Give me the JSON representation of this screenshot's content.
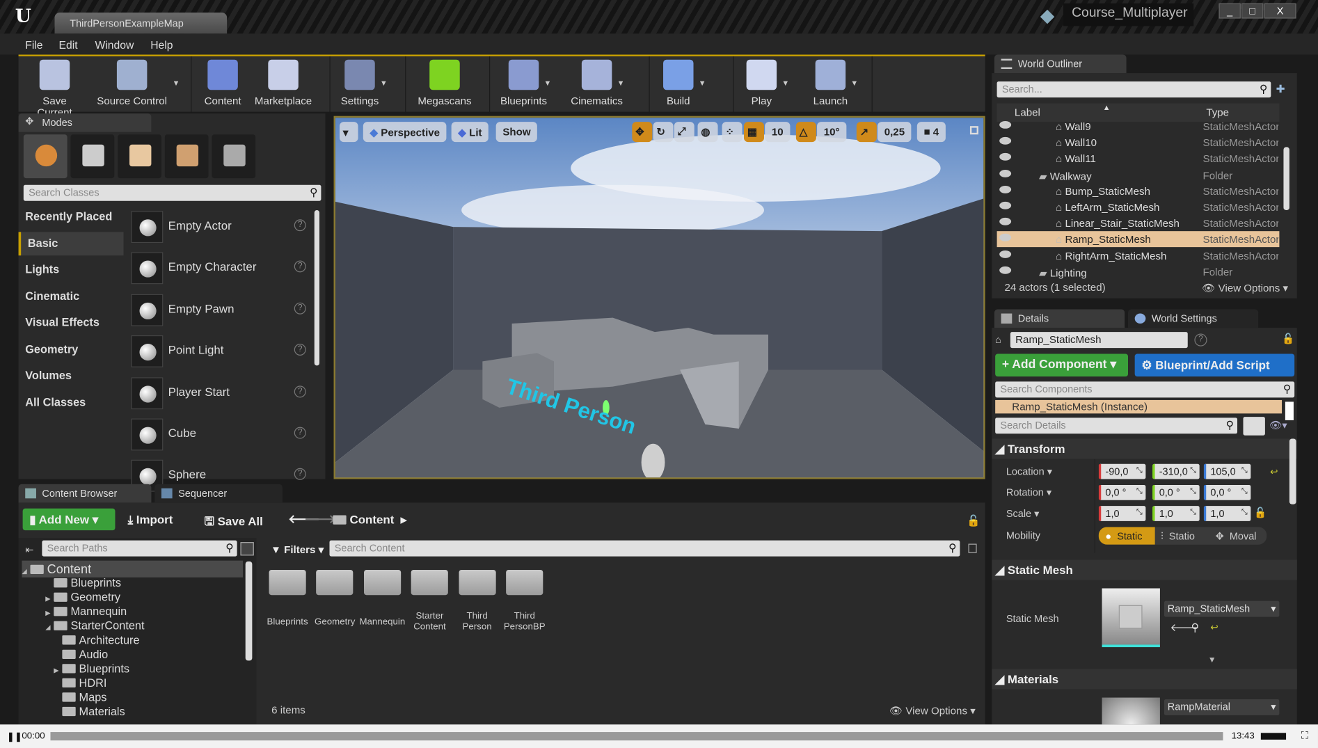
{
  "window": {
    "doc_tab": "ThirdPersonExampleMap",
    "project": "Course_Multiplayer",
    "min": "_",
    "max": "□",
    "close": "X"
  },
  "menu": [
    "File",
    "Edit",
    "Window",
    "Help"
  ],
  "toolbar": [
    {
      "label": "Save Current",
      "icon": "save-icon",
      "color": "#b9c3e0"
    },
    {
      "label": "Source Control",
      "icon": "source-control-icon",
      "color": "#9fb0d0",
      "dd": true
    },
    {
      "label": "Content",
      "icon": "content-icon",
      "color": "#6f88d8"
    },
    {
      "label": "Marketplace",
      "icon": "marketplace-icon",
      "color": "#c8cfe8"
    },
    {
      "label": "Settings",
      "icon": "settings-icon",
      "color": "#7a88b0",
      "dd": true
    },
    {
      "label": "Megascans",
      "icon": "megascans-icon",
      "color": "#7ed321"
    },
    {
      "label": "Blueprints",
      "icon": "blueprints-icon",
      "color": "#8a9bd0",
      "dd": true
    },
    {
      "label": "Cinematics",
      "icon": "cinematics-icon",
      "color": "#a6b3da",
      "dd": true
    },
    {
      "label": "Build",
      "icon": "build-icon",
      "color": "#7aa0e6",
      "dd": true
    },
    {
      "label": "Play",
      "icon": "play-icon",
      "color": "#d0d8f0",
      "dd": true
    },
    {
      "label": "Launch",
      "icon": "launch-icon",
      "color": "#9fb0d8",
      "dd": true
    }
  ],
  "modes": {
    "tab": "Modes",
    "search_placeholder": "Search Classes",
    "categories": [
      "Recently Placed",
      "Basic",
      "Lights",
      "Cinematic",
      "Visual Effects",
      "Geometry",
      "Volumes",
      "All Classes"
    ],
    "selected_category": "Basic",
    "items": [
      "Empty Actor",
      "Empty Character",
      "Empty Pawn",
      "Point Light",
      "Player Start",
      "Cube",
      "Sphere"
    ]
  },
  "viewport": {
    "perspective": "Perspective",
    "lit": "Lit",
    "show": "Show",
    "grid_snap": "10",
    "rot_snap": "10°",
    "scale_snap": "0,25",
    "camera_speed": "4",
    "floor_text": "Third Person"
  },
  "content_browser": {
    "tabs": [
      "Content Browser",
      "Sequencer"
    ],
    "add_new": "Add New",
    "import": "Import",
    "save_all": "Save All",
    "path": "Content",
    "search_paths": "Search Paths",
    "filters": "Filters",
    "search_content": "Search Content",
    "tree": [
      {
        "label": "Content",
        "depth": 0,
        "arrow": "◢"
      },
      {
        "label": "Blueprints",
        "depth": 1
      },
      {
        "label": "Geometry",
        "depth": 1,
        "arrow": "▶"
      },
      {
        "label": "Mannequin",
        "depth": 1,
        "arrow": "▶"
      },
      {
        "label": "StarterContent",
        "depth": 1,
        "arrow": "◢"
      },
      {
        "label": "Architecture",
        "depth": 2
      },
      {
        "label": "Audio",
        "depth": 2
      },
      {
        "label": "Blueprints",
        "depth": 2,
        "arrow": "▶"
      },
      {
        "label": "HDRI",
        "depth": 2
      },
      {
        "label": "Maps",
        "depth": 2
      },
      {
        "label": "Materials",
        "depth": 2
      }
    ],
    "folders": [
      "Blueprints",
      "Geometry",
      "Mannequin",
      "Starter Content",
      "Third Person",
      "Third PersonBP"
    ],
    "count": "6 items",
    "view_options": "View Options"
  },
  "outliner": {
    "tab": "World Outliner",
    "search_placeholder": "Search...",
    "col_label": "Label",
    "col_type": "Type",
    "rows": [
      {
        "label": "Wall9",
        "type": "StaticMeshActor",
        "indent": 2
      },
      {
        "label": "Wall10",
        "type": "StaticMeshActor",
        "indent": 2
      },
      {
        "label": "Wall11",
        "type": "StaticMeshActor",
        "indent": 2
      },
      {
        "label": "Walkway",
        "type": "Folder",
        "indent": 1,
        "folder": true
      },
      {
        "label": "Bump_StaticMesh",
        "type": "StaticMeshActor",
        "indent": 2
      },
      {
        "label": "LeftArm_StaticMesh",
        "type": "StaticMeshActor",
        "indent": 2
      },
      {
        "label": "Linear_Stair_StaticMesh",
        "type": "StaticMeshActor",
        "indent": 2
      },
      {
        "label": "Ramp_StaticMesh",
        "type": "StaticMeshActor",
        "indent": 2,
        "selected": true
      },
      {
        "label": "RightArm_StaticMesh",
        "type": "StaticMeshActor",
        "indent": 2
      },
      {
        "label": "Lighting",
        "type": "Folder",
        "indent": 1,
        "folder": true
      }
    ],
    "footer": "24 actors (1 selected)",
    "view_options": "View Options"
  },
  "details": {
    "tabs": [
      "Details",
      "World Settings"
    ],
    "name": "Ramp_StaticMesh",
    "add_component": "Add Component",
    "blueprint": "Blueprint/Add Script",
    "search_components": "Search Components",
    "instance": "Ramp_StaticMesh (Instance)",
    "search_details": "Search Details",
    "transform": "Transform",
    "location_label": "Location",
    "rotation_label": "Rotation",
    "scale_label": "Scale",
    "mobility_label": "Mobility",
    "location": [
      "-90,0",
      "-310,0",
      "105,0"
    ],
    "rotation": [
      "0,0 °",
      "0,0 °",
      "0,0 °"
    ],
    "scale": [
      "1,0",
      "1,0",
      "1,0"
    ],
    "mobility": [
      "Static",
      "Statio",
      "Moval"
    ],
    "mobility_selected": "Static",
    "static_mesh_section": "Static Mesh",
    "static_mesh_label": "Static Mesh",
    "static_mesh_value": "Ramp_StaticMesh",
    "materials_section": "Materials",
    "material_value": "RampMaterial"
  },
  "video": {
    "current": "00:00",
    "duration": "13:43",
    "progress": 0
  }
}
